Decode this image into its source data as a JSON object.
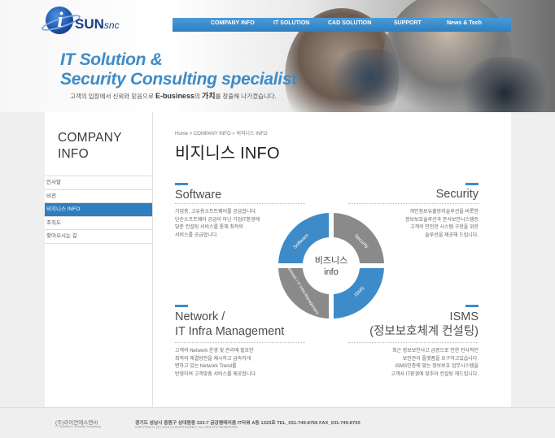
{
  "logo": {
    "text": "SUN",
    "suffix": "snc",
    "mark": "i"
  },
  "nav": {
    "items": [
      "COMPANY INFO",
      "IT SOLUTION",
      "CAD SOLUTION",
      "SUPPORT",
      "News & Tech"
    ]
  },
  "hero": {
    "title_line1": "IT Solution &",
    "title_line2": "Security Consulting specialist",
    "subtitle_pre": "고객의 입장에서 신뢰와 믿음으로 ",
    "subtitle_brand": "E-business",
    "subtitle_mid": "의 ",
    "subtitle_strong": "가치",
    "subtitle_post": "를 창출해 나가겠습니다."
  },
  "sidebar": {
    "title_line1": "COMPANY",
    "title_line2": "INFO",
    "items": [
      "인사말",
      "비전",
      "비지니스 INFO",
      "조직도",
      "찾아오시는 길"
    ],
    "active_index": 2
  },
  "main": {
    "breadcrumb": "Home > COMPANY INFO > 비지니스 INFO",
    "title": "비지니스 INFO",
    "software": {
      "title": "Software",
      "desc": [
        "기업용, 고유용소프트웨어를 공급합니다.",
        "단순소프트웨어 공급이 아닌 기업IT환경에",
        "맞춘 컨설팅 서비스를 통해 최적의",
        "서비스를 공급합니다."
      ]
    },
    "security": {
      "title": "Security",
      "desc": [
        "개인정보유출방지솔루션을 비롯한",
        "정보보호솔루션과 문서보안시스템등",
        "고객의 안전한 시스템 구현을 위한",
        "솔루션을 제공해 드립니다."
      ]
    },
    "network": {
      "title_line1": "Network /",
      "title_line2": "IT Infra Management",
      "desc": [
        "고객의 Network 운영 및 관리에 필요한",
        "최적의 해결방안을 제시하고 급속하게",
        "변하고 있는 Network Trend를",
        "반영하여 고객맞춤 서비스를 제공합니다."
      ]
    },
    "isms": {
      "title_line1": "ISMS",
      "title_line2": "(정보보호체계 컨설팅)",
      "desc": [
        "최근 정보보안사고 급증으로 인한 전사적인",
        "보안관리 플랫폼을 요구하고있습니다.",
        "ISMS인증에 맞는 정보보호 업무시스템을",
        "고객사 IT환경에 맞추어 컨설팅 해드립니다."
      ]
    },
    "donut": {
      "center_line1": "비즈니스",
      "center_line2": "info",
      "segments": [
        "Software",
        "Security",
        "ISMS",
        "Network / IT Infra Management"
      ],
      "colors": {
        "blue": "#3d8bc8",
        "gray": "#8a8a8a"
      }
    }
  },
  "footer": {
    "company": "(주)라이언에스앤씨",
    "company_sub": "IT Solution & Security Consulting",
    "address": "경기도 성남시 중원구 상대원동 333-7 금강펜테리움 IT타워 A동 1323호   TEL_031-749-8756  FAX_031-749-8755",
    "copyright": "COPYRIGHT (C) 2010 CLIPARTKOREA. ALL RIGHTS RESERVED."
  }
}
